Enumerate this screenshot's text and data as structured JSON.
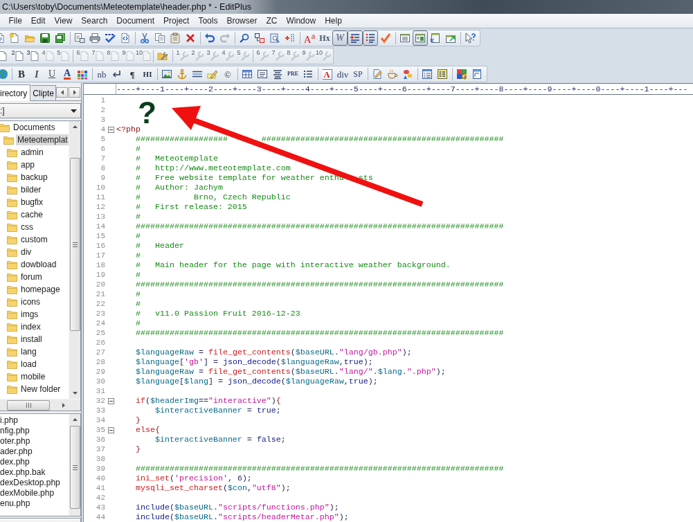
{
  "window": {
    "title": "C:\\Users\\toby\\Documents\\Meteotemplate\\header.php * - EditPlus"
  },
  "menu": [
    "File",
    "Edit",
    "View",
    "Search",
    "Document",
    "Project",
    "Tools",
    "Browser",
    "ZC",
    "Window",
    "Help"
  ],
  "main_toolbar": {
    "groups": [
      [
        {
          "disabled": false
        },
        {
          "disabled": false
        },
        {
          "disabled": false
        },
        {
          "disabled": false
        },
        {
          "disabled": false
        }
      ],
      [
        {
          "disabled": false
        },
        {
          "disabled": false
        },
        {
          "disabled": false
        },
        {
          "disabled": false
        }
      ],
      [
        {
          "disabled": false
        },
        {
          "disabled": false
        },
        {
          "disabled": false
        },
        {
          "disabled": false
        }
      ],
      [
        {
          "disabled": false
        },
        {
          "disabled": true
        }
      ],
      [
        {
          "disabled": false
        },
        {
          "disabled": false
        },
        {
          "disabled": false
        },
        {
          "disabled": false
        }
      ],
      [
        {
          "label": "A$^{a}$",
          "disabled": false
        },
        {
          "label": "Hx",
          "disabled": false
        },
        {
          "label": "W",
          "disabled": false,
          "pressed": true
        },
        {
          "disabled": false,
          "pressed": true
        },
        {
          "disabled": false,
          "pressed": true
        },
        {
          "disabled": false
        }
      ],
      [
        {
          "disabled": false
        },
        {
          "disabled": false,
          "pressed": true
        },
        {
          "disabled": false
        },
        {
          "disabled": false
        }
      ],
      [
        {
          "disabled": false
        }
      ]
    ]
  },
  "document_toolbar": {
    "groups": [
      [
        {
          "disabled": false
        },
        {
          "label": "2",
          "disabled": false
        },
        {
          "label": "3",
          "disabled": false
        },
        {
          "label": "4",
          "disabled": true
        },
        {
          "label": "5",
          "disabled": true
        }
      ],
      [
        {
          "label": "6",
          "disabled": true
        },
        {
          "label": "7",
          "disabled": true
        },
        {
          "label": "8",
          "disabled": true
        },
        {
          "label": "9",
          "disabled": true
        },
        {
          "label": "10",
          "disabled": true
        }
      ],
      [
        {
          "disabled": false
        }
      ],
      [
        {
          "label": "1",
          "disabled": true
        },
        {
          "label": "2",
          "disabled": true
        },
        {
          "label": "3",
          "disabled": true
        },
        {
          "label": "4",
          "disabled": true
        },
        {
          "label": "5",
          "disabled": true
        }
      ],
      [
        {
          "label": "6",
          "disabled": true
        },
        {
          "label": "7",
          "disabled": true
        },
        {
          "label": "8",
          "disabled": true
        },
        {
          "label": "9",
          "disabled": true
        },
        {
          "label": "10",
          "disabled": true
        }
      ]
    ]
  },
  "html_toolbar": {
    "groups": [
      [
        {
          "disabled": false
        }
      ],
      [
        {
          "label": "B",
          "disabled": false
        },
        {
          "label": "I",
          "disabled": false
        },
        {
          "label": "U",
          "disabled": false
        },
        {
          "label": "A",
          "disabled": false
        },
        {
          "disabled": false
        }
      ],
      [
        {
          "label": "nb",
          "disabled": false
        },
        {
          "disabled": false
        },
        {
          "label": "¶",
          "disabled": false
        },
        {
          "label": "HI",
          "disabled": false
        }
      ],
      [
        {
          "disabled": false
        },
        {
          "disabled": false
        },
        {
          "disabled": false
        },
        {
          "disabled": false
        },
        {
          "label": "©",
          "disabled": false
        }
      ],
      [
        {
          "disabled": false
        },
        {
          "disabled": false
        },
        {
          "disabled": false
        },
        {
          "label": "PRE",
          "disabled": false
        },
        {
          "disabled": false
        }
      ],
      [
        {
          "label": "A",
          "disabled": false
        },
        {
          "label": "div",
          "disabled": false
        },
        {
          "label": "SP",
          "disabled": false
        }
      ],
      [
        {
          "disabled": false
        },
        {
          "disabled": false
        },
        {
          "disabled": false
        }
      ],
      [
        {
          "disabled": false
        },
        {
          "disabled": false
        }
      ],
      [
        {
          "disabled": false
        },
        {
          "disabled": false
        }
      ]
    ]
  },
  "sidebar": {
    "tabs": [
      {
        "label": "irectory",
        "selected": true
      },
      {
        "label": "Clipte",
        "selected": false
      }
    ],
    "drive": ":]",
    "tree": [
      {
        "label": "Documents",
        "selected": false,
        "children": [
          {
            "label": "Meteotemplat",
            "selected": true,
            "children": [
              {
                "label": "admin",
                "selected": false
              },
              {
                "label": "app",
                "selected": false
              },
              {
                "label": "backup",
                "selected": false
              },
              {
                "label": "bilder",
                "selected": false
              },
              {
                "label": "bugfix",
                "selected": false
              },
              {
                "label": "cache",
                "selected": false
              },
              {
                "label": "css",
                "selected": false
              },
              {
                "label": "custom",
                "selected": false
              },
              {
                "label": "div",
                "selected": false
              },
              {
                "label": "dowbload",
                "selected": false
              },
              {
                "label": "forum",
                "selected": false
              },
              {
                "label": "homepage",
                "selected": false
              },
              {
                "label": "icons",
                "selected": false
              },
              {
                "label": "imgs",
                "selected": false
              },
              {
                "label": "index",
                "selected": false
              },
              {
                "label": "install",
                "selected": false
              },
              {
                "label": "lang",
                "selected": false
              },
              {
                "label": "load",
                "selected": false
              },
              {
                "label": "mobile",
                "selected": false
              },
              {
                "label": "New folder",
                "selected": false
              }
            ]
          }
        ]
      }
    ],
    "files": [
      "i.php",
      "nfig.php",
      "oter.php",
      "ader.php",
      "dex.php",
      "dex.php.bak",
      "dexDesktop.php",
      "dexMobile.php",
      "enu.php"
    ]
  },
  "editor": {
    "ruler": "----+----1----+----2----+----3----+----4----+----5----+----6----+----7----+----8----+----9----+----0----+----1----+---",
    "annotation": "?",
    "lines": [
      {
        "number": "1"
      },
      {
        "number": "2"
      },
      {
        "number": "3"
      },
      {
        "number": "4",
        "fold": {
          "expanded": true
        },
        "tokens": [
          {
            "kind": "tag",
            "text": "<?php"
          }
        ]
      },
      {
        "number": "5",
        "tokens": [
          {
            "kind": "comment",
            "text": "    ###################"
          },
          {
            "kind": "comment",
            "text": "       ##################################################"
          }
        ]
      },
      {
        "number": "6",
        "tokens": [
          {
            "kind": "comment",
            "text": "    #"
          }
        ]
      },
      {
        "number": "7",
        "tokens": [
          {
            "kind": "comment",
            "text": "    #   Meteotemplate"
          }
        ]
      },
      {
        "number": "8",
        "tokens": [
          {
            "kind": "comment",
            "text": "    #   http://www.meteotemplate.com"
          }
        ]
      },
      {
        "number": "9",
        "tokens": [
          {
            "kind": "comment",
            "text": "    #   Free website template for weather enthu"
          },
          {
            "kind": "comment",
            "text": "   sts"
          }
        ]
      },
      {
        "number": "10",
        "tokens": [
          {
            "kind": "comment",
            "text": "    #   Author: Jachym"
          }
        ]
      },
      {
        "number": "11",
        "tokens": [
          {
            "kind": "comment",
            "text": "    #           Brno, Czech Republic"
          }
        ]
      },
      {
        "number": "12",
        "tokens": [
          {
            "kind": "comment",
            "text": "    #   First release: 2015"
          }
        ]
      },
      {
        "number": "13",
        "tokens": [
          {
            "kind": "comment",
            "text": "    #"
          }
        ]
      },
      {
        "number": "14",
        "tokens": [
          {
            "kind": "comment",
            "text": "    ############################################################################"
          }
        ]
      },
      {
        "number": "15",
        "tokens": [
          {
            "kind": "comment",
            "text": "    #"
          }
        ]
      },
      {
        "number": "16",
        "tokens": [
          {
            "kind": "comment",
            "text": "    #   Header"
          }
        ]
      },
      {
        "number": "17",
        "tokens": [
          {
            "kind": "comment",
            "text": "    #"
          }
        ]
      },
      {
        "number": "18",
        "tokens": [
          {
            "kind": "comment",
            "text": "    #   Main header for the page with interactive weather background."
          }
        ]
      },
      {
        "number": "19",
        "tokens": [
          {
            "kind": "comment",
            "text": "    #"
          }
        ]
      },
      {
        "number": "20",
        "tokens": [
          {
            "kind": "comment",
            "text": "    ############################################################################"
          }
        ]
      },
      {
        "number": "21",
        "tokens": [
          {
            "kind": "comment",
            "text": "    #"
          }
        ]
      },
      {
        "number": "22",
        "tokens": [
          {
            "kind": "comment",
            "text": "    #"
          }
        ]
      },
      {
        "number": "23",
        "tokens": [
          {
            "kind": "comment",
            "text": "    #   v11.0 Passion Fruit 2016-12-23"
          }
        ]
      },
      {
        "number": "24",
        "tokens": [
          {
            "kind": "comment",
            "text": "    #"
          }
        ]
      },
      {
        "number": "25",
        "tokens": [
          {
            "kind": "comment",
            "text": "    ############################################################################"
          }
        ]
      },
      {
        "number": "26"
      },
      {
        "number": "27",
        "tokens": [
          {
            "kind": "variable",
            "text": "    $languageRaw"
          },
          {
            "kind": "operator",
            "text": " = "
          },
          {
            "kind": "function",
            "text": "file_get_contents"
          },
          {
            "kind": "operator",
            "text": "("
          },
          {
            "kind": "variable",
            "text": "$baseURL"
          },
          {
            "kind": "operator",
            "text": "."
          },
          {
            "kind": "string",
            "text": "\"lang/gb.php\""
          },
          {
            "kind": "operator",
            "text": ");"
          }
        ]
      },
      {
        "number": "28",
        "tokens": [
          {
            "kind": "variable",
            "text": "    $language"
          },
          {
            "kind": "operator",
            "text": "["
          },
          {
            "kind": "string",
            "text": "'gb'"
          },
          {
            "kind": "operator",
            "text": "] = "
          },
          {
            "kind": "builtin",
            "text": "json_decode"
          },
          {
            "kind": "operator",
            "text": "("
          },
          {
            "kind": "variable",
            "text": "$languageRaw"
          },
          {
            "kind": "operator",
            "text": ","
          },
          {
            "kind": "constant",
            "text": "true"
          },
          {
            "kind": "operator",
            "text": ");"
          }
        ]
      },
      {
        "number": "29",
        "tokens": [
          {
            "kind": "variable",
            "text": "    $languageRaw"
          },
          {
            "kind": "operator",
            "text": " = "
          },
          {
            "kind": "function",
            "text": "file_get_contents"
          },
          {
            "kind": "operator",
            "text": "("
          },
          {
            "kind": "variable",
            "text": "$baseURL"
          },
          {
            "kind": "operator",
            "text": "."
          },
          {
            "kind": "string",
            "text": "\"lang/\""
          },
          {
            "kind": "operator",
            "text": "."
          },
          {
            "kind": "variable",
            "text": "$lang"
          },
          {
            "kind": "operator",
            "text": "."
          },
          {
            "kind": "string",
            "text": "\".php\""
          },
          {
            "kind": "operator",
            "text": ");"
          }
        ]
      },
      {
        "number": "30",
        "tokens": [
          {
            "kind": "variable",
            "text": "    $language"
          },
          {
            "kind": "operator",
            "text": "["
          },
          {
            "kind": "variable",
            "text": "$lang"
          },
          {
            "kind": "operator",
            "text": "] = "
          },
          {
            "kind": "builtin",
            "text": "json_decode"
          },
          {
            "kind": "operator",
            "text": "("
          },
          {
            "kind": "variable",
            "text": "$languageRaw"
          },
          {
            "kind": "operator",
            "text": ","
          },
          {
            "kind": "constant",
            "text": "true"
          },
          {
            "kind": "operator",
            "text": ");"
          }
        ]
      },
      {
        "number": "31"
      },
      {
        "number": "32",
        "fold": {
          "expanded": true
        },
        "tokens": [
          {
            "kind": "keyword",
            "text": "    if"
          },
          {
            "kind": "operator",
            "text": "("
          },
          {
            "kind": "variable",
            "text": "$headerImg"
          },
          {
            "kind": "operator",
            "text": "=="
          },
          {
            "kind": "string",
            "text": "\"interactive\""
          },
          {
            "kind": "operator",
            "text": ")"
          },
          {
            "kind": "brace",
            "text": "{"
          }
        ]
      },
      {
        "number": "33",
        "tokens": [
          {
            "kind": "variable",
            "text": "        $interactiveBanner"
          },
          {
            "kind": "operator",
            "text": " = "
          },
          {
            "kind": "constant",
            "text": "true"
          },
          {
            "kind": "operator",
            "text": ";"
          }
        ]
      },
      {
        "number": "34",
        "tokens": [
          {
            "kind": "brace",
            "text": "    }"
          }
        ]
      },
      {
        "number": "35",
        "fold": {
          "expanded": true
        },
        "tokens": [
          {
            "kind": "keyword",
            "text": "    else"
          },
          {
            "kind": "brace",
            "text": "{"
          }
        ]
      },
      {
        "number": "36",
        "tokens": [
          {
            "kind": "variable",
            "text": "        $interactiveBanner"
          },
          {
            "kind": "operator",
            "text": " = "
          },
          {
            "kind": "constant",
            "text": "false"
          },
          {
            "kind": "operator",
            "text": ";"
          }
        ]
      },
      {
        "number": "37",
        "tokens": [
          {
            "kind": "brace",
            "text": "    }"
          }
        ]
      },
      {
        "number": "38"
      },
      {
        "number": "39",
        "tokens": [
          {
            "kind": "comment",
            "text": "    ############################################################################"
          }
        ]
      },
      {
        "number": "40",
        "tokens": [
          {
            "kind": "function",
            "text": "    ini_set"
          },
          {
            "kind": "operator",
            "text": "("
          },
          {
            "kind": "string",
            "text": "'precision'"
          },
          {
            "kind": "operator",
            "text": ", 6);"
          }
        ]
      },
      {
        "number": "41",
        "tokens": [
          {
            "kind": "function",
            "text": "    mysqli_set_charset"
          },
          {
            "kind": "operator",
            "text": "("
          },
          {
            "kind": "variable",
            "text": "$con"
          },
          {
            "kind": "operator",
            "text": ","
          },
          {
            "kind": "string",
            "text": "\"utf8\""
          },
          {
            "kind": "operator",
            "text": ");"
          }
        ]
      },
      {
        "number": "42"
      },
      {
        "number": "43",
        "tokens": [
          {
            "kind": "builtin",
            "text": "    include"
          },
          {
            "kind": "operator",
            "text": "("
          },
          {
            "kind": "variable",
            "text": "$baseURL"
          },
          {
            "kind": "operator",
            "text": "."
          },
          {
            "kind": "string",
            "text": "\"scripts/functions.php\""
          },
          {
            "kind": "operator",
            "text": ");"
          }
        ]
      },
      {
        "number": "44",
        "tokens": [
          {
            "kind": "builtin",
            "text": "    include"
          },
          {
            "kind": "operator",
            "text": "("
          },
          {
            "kind": "variable",
            "text": "$baseURL"
          },
          {
            "kind": "operator",
            "text": "."
          },
          {
            "kind": "string",
            "text": "\"scripts/headerMetar.php\""
          },
          {
            "kind": "operator",
            "text": ");"
          }
        ]
      }
    ]
  }
}
